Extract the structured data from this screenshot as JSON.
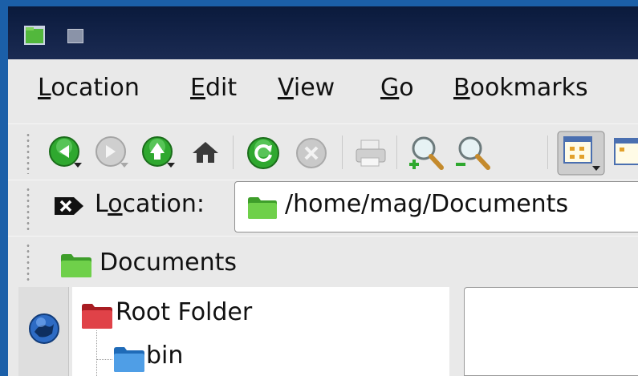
{
  "menubar": {
    "items": [
      {
        "pre": "",
        "acc": "L",
        "post": "ocation"
      },
      {
        "pre": "",
        "acc": "E",
        "post": "dit"
      },
      {
        "pre": "",
        "acc": "V",
        "post": "iew"
      },
      {
        "pre": "",
        "acc": "G",
        "post": "o"
      },
      {
        "pre": "",
        "acc": "B",
        "post": "ookmarks"
      }
    ]
  },
  "toolbar": {
    "buttons": [
      "back-icon",
      "forward-icon",
      "up-icon",
      "home-icon",
      "reload-icon",
      "stop-icon",
      "print-icon",
      "zoom-in-icon",
      "zoom-out-icon",
      "icon-view-icon",
      "list-view-icon"
    ]
  },
  "location": {
    "label_pre": "L",
    "label_acc": "o",
    "label_post": "cation:",
    "path": "/home/mag/Documents"
  },
  "breadcrumb": {
    "label": "Documents"
  },
  "tree": {
    "root": "Root Folder",
    "child": "bin"
  },
  "colors": {
    "folder_green": "#5fc43a",
    "folder_red": "#d8353a",
    "folder_blue": "#3f8fd8",
    "nav_green": "#2fa82f",
    "desktop_blue": "#1b5fa8"
  }
}
